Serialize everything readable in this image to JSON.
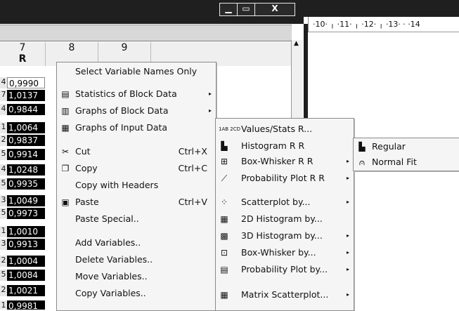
{
  "window": {
    "min_glyph": "▁",
    "max_glyph": "▭",
    "close_glyph": "X"
  },
  "ruler": {
    "text": "·10· ╷ ·11· ╷ ·12· ╷ ·13· · ·14"
  },
  "grid": {
    "columns": [
      {
        "number": "7",
        "name": "R"
      },
      {
        "number": "8",
        "name": ""
      },
      {
        "number": "9",
        "name": ""
      }
    ],
    "rows": [
      {
        "num": "4",
        "value": "0,9990"
      },
      {
        "num": "7",
        "value": "1,0137"
      },
      {
        "num": "4",
        "value": "0,9844"
      },
      {
        "num": "1",
        "value": "1,0064"
      },
      {
        "num": "2",
        "value": "0,9837"
      },
      {
        "num": "5",
        "value": "0,9914"
      },
      {
        "num": "4",
        "value": "1,0248"
      },
      {
        "num": "5",
        "value": "0,9935"
      },
      {
        "num": "3",
        "value": "1,0049"
      },
      {
        "num": "5",
        "value": "0,9973"
      },
      {
        "num": "1",
        "value": "1,0010"
      },
      {
        "num": "3",
        "value": "0,9913"
      },
      {
        "num": "2",
        "value": "1,0004"
      },
      {
        "num": "5",
        "value": "1,0084"
      },
      {
        "num": "2",
        "value": "1,0021"
      },
      {
        "num": "1",
        "value": "0,9981"
      }
    ]
  },
  "context_menu": {
    "select_names": "Select Variable Names Only",
    "stats_block": "Statistics of Block Data",
    "graphs_block": "Graphs of Block Data",
    "graphs_input": "Graphs of Input Data",
    "cut": "Cut",
    "cut_sc": "Ctrl+X",
    "copy": "Copy",
    "copy_sc": "Ctrl+C",
    "copy_headers": "Copy with Headers",
    "paste": "Paste",
    "paste_sc": "Ctrl+V",
    "paste_special": "Paste Special..",
    "add_vars": "Add Variables..",
    "delete_vars": "Delete Variables..",
    "move_vars": "Move Variables..",
    "copy_vars": "Copy Variables.."
  },
  "graphs_submenu": {
    "values_stats": "Values/Stats R...",
    "histogram": "Histogram R R",
    "box_whisker": "Box-Whisker R R",
    "prob_plot": "Probability Plot R R",
    "scatter_by": "Scatterplot by...",
    "hist2d_by": "2D Histogram by...",
    "hist3d_by": "3D Histogram by...",
    "boxw_by": "Box-Whisker by...",
    "prob_by": "Probability Plot by...",
    "matrix_scatter": "Matrix Scatterplot..."
  },
  "histogram_submenu": {
    "regular": "Regular",
    "normal_fit": "Normal Fit"
  },
  "icons": {
    "arrow": "▸"
  }
}
